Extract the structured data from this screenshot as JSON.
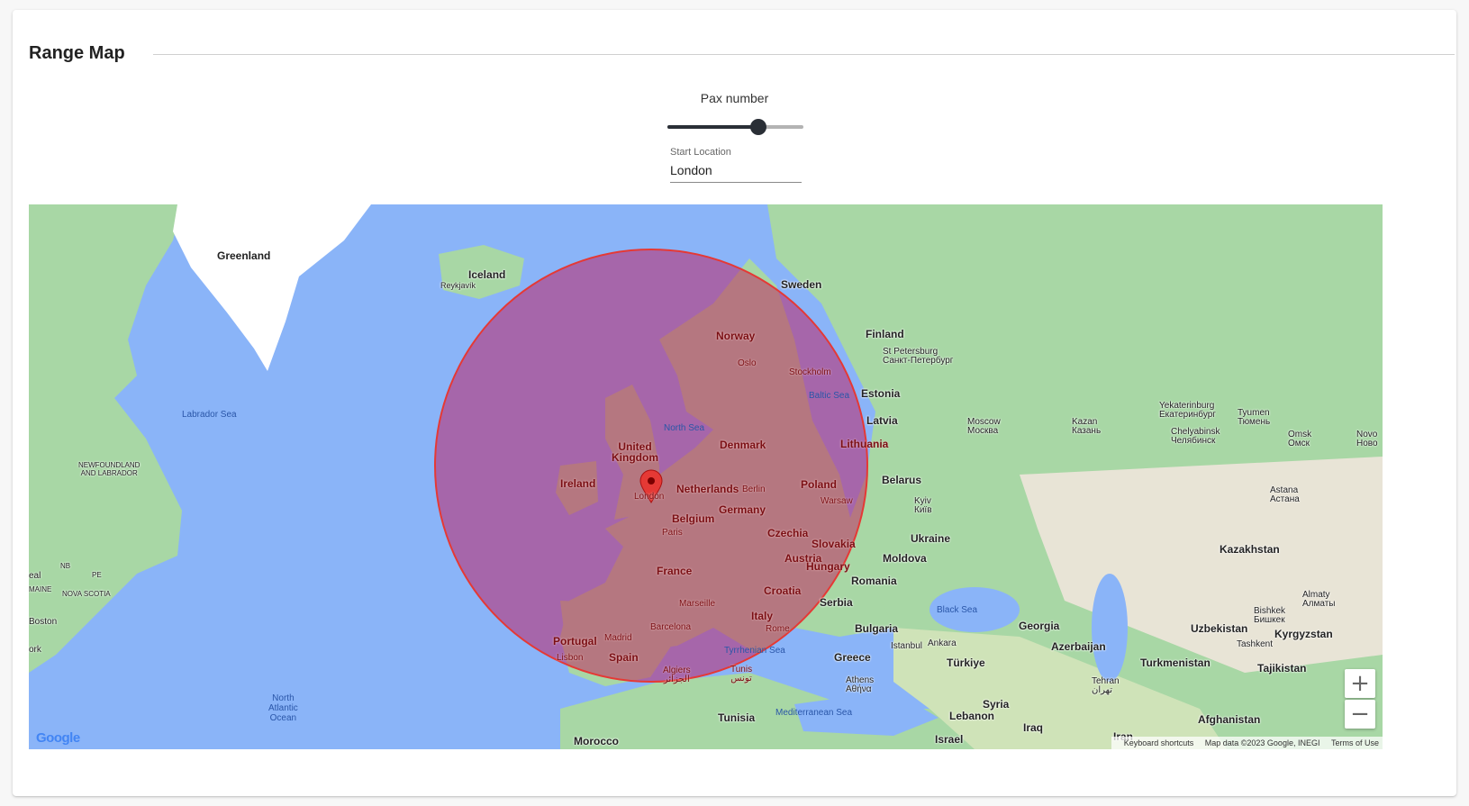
{
  "title": "Range Map",
  "slider": {
    "label": "Pax number",
    "value_fraction": 0.67
  },
  "start_location": {
    "label": "Start Location",
    "value": "London"
  },
  "map": {
    "circle_fill": "#c2185b",
    "circle_stroke": "#e53935",
    "marker_color": "#e53935",
    "labels": {
      "greenland": "Greenland",
      "iceland": "Iceland",
      "reykjavik": "Reykjavík",
      "sweden": "Sweden",
      "norway": "Norway",
      "oslo": "Oslo",
      "stockholm": "Stockholm",
      "finland": "Finland",
      "st_petersburg": "St Petersburg\nСанкт-Петербург",
      "estonia": "Estonia",
      "latvia": "Latvia",
      "lithuania": "Lithuania",
      "baltic_sea": "Baltic Sea",
      "north_sea": "North Sea",
      "denmark": "Denmark",
      "uk": "United\nKingdom",
      "ireland": "Ireland",
      "london": "London",
      "netherlands": "Netherlands",
      "berlin": "Berlin",
      "poland": "Poland",
      "warsaw": "Warsaw",
      "belgium": "Belgium",
      "germany": "Germany",
      "paris": "Paris",
      "czechia": "Czechia",
      "slovakia": "Slovakia",
      "france": "France",
      "austria": "Austria",
      "hungary": "Hungary",
      "croatia": "Croatia",
      "marseille": "Marseille",
      "italy": "Italy",
      "rome": "Rome",
      "barcelona": "Barcelona",
      "portugal": "Portugal",
      "madrid": "Madrid",
      "spain": "Spain",
      "lisbon": "Lisbon",
      "tyrrhenian": "Tyrrhenian Sea",
      "algiers": "Algiers\nالجزائر",
      "tunis": "Tunis\nتونس",
      "tunisia": "Tunisia",
      "morocco": "Morocco",
      "mediterranean": "Mediterranean Sea",
      "belarus": "Belarus",
      "kyiv": "Kyiv\nКиїв",
      "ukraine": "Ukraine",
      "moldova": "Moldova",
      "romania": "Romania",
      "serbia": "Serbia",
      "bulgaria": "Bulgaria",
      "istanbul": "Istanbul",
      "ankara": "Ankara",
      "turkiye": "Türkiye",
      "greece": "Greece",
      "athens": "Athens\nΑθήνα",
      "black_sea": "Black Sea",
      "georgia": "Georgia",
      "azerbaijan": "Azerbaijan",
      "syria": "Syria",
      "lebanon": "Lebanon",
      "israel": "Israel",
      "iraq": "Iraq",
      "iran": "Iran",
      "tehran": "Tehran\nتهران",
      "turkmenistan": "Turkmenistan",
      "uzbekistan": "Uzbekistan",
      "tashkent": "Tashkent",
      "kyrgyzstan": "Kyrgyzstan",
      "tajikistan": "Tajikistan",
      "afghanistan": "Afghanistan",
      "kazakhstan": "Kazakhstan",
      "astana": "Astana\nАстана",
      "almaty": "Almaty\nАлматы",
      "bishkek": "Bishkek\nБишкек",
      "moscow": "Moscow\nМосква",
      "kazan": "Kazan\nКазань",
      "yekaterinburg": "Yekaterinburg\nЕкатеринбург",
      "tyumen": "Tyumen\nТюмень",
      "chelyabinsk": "Chelyabinsk\nЧелябинск",
      "omsk": "Omsk\nОмск",
      "novo": "Novo\nНово",
      "labrador_sea": "Labrador Sea",
      "newfoundland": "NEWFOUNDLAND\nAND LABRADOR",
      "nb": "NB",
      "pe": "PE",
      "nova_scotia": "NOVA SCOTIA",
      "maine": "MAINE",
      "eal": "eal",
      "boston": "Boston",
      "ork": "ork",
      "north_atlantic": "North\nAtlantic\nOcean"
    },
    "zoom_in": "+",
    "zoom_out": "−",
    "keyboard_shortcuts": "Keyboard shortcuts",
    "map_data": "Map data ©2023 Google, INEGI",
    "terms": "Terms of Use",
    "google_logo": "Google"
  }
}
